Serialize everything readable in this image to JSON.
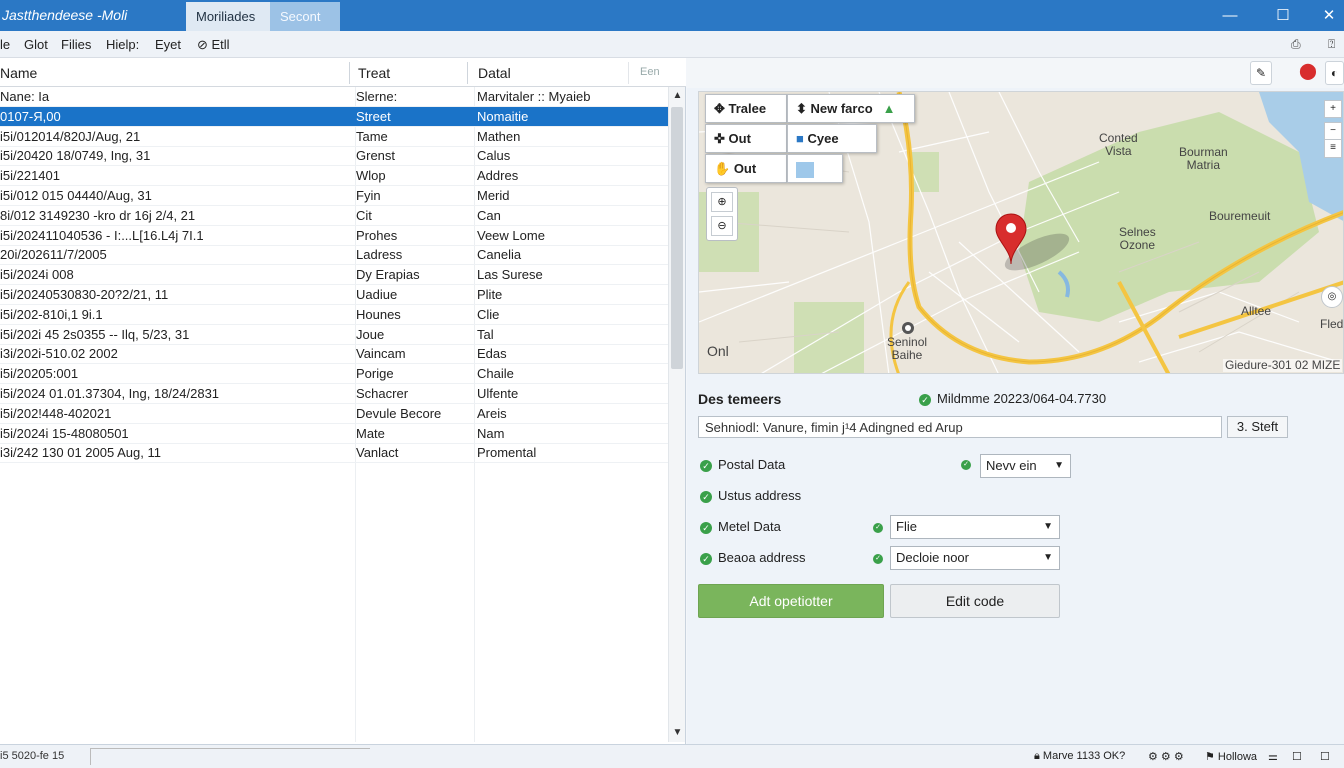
{
  "window": {
    "title": "Jastthendeese -Moli",
    "tabs": [
      "Moriliades",
      "Secont"
    ],
    "controls": {
      "minimize": "—",
      "maximize": "☐",
      "close": "✕"
    }
  },
  "menu": {
    "items": [
      "le",
      "Glot",
      "Filies",
      "Hielp:",
      "Eyet",
      "Etll"
    ],
    "right_icons": [
      "print-icon",
      "help-icon"
    ]
  },
  "table": {
    "columns": [
      "Name",
      "Treat",
      "Datal"
    ],
    "extra_header": "Een",
    "selected_index": 1,
    "rows": [
      [
        "Nane: Ia",
        "Slerne:",
        "Marvitaler :: Myaieb"
      ],
      [
        "0107-Я,00",
        "Street",
        "Nomaitie"
      ],
      [
        "i5i/012014/820J/Aug, 21",
        "Tame",
        "Mathen"
      ],
      [
        "i5i/20420 18/0749, Ing, 31",
        "Grenst",
        "Calus"
      ],
      [
        "i5i/221401",
        "Wlop",
        "Addres"
      ],
      [
        "i5i/012 015 04440/Aug, 31",
        "Fyin",
        "Merid"
      ],
      [
        "8i/012 3149230 -kro dr 16j 2/4, 21",
        "Cit",
        "Can"
      ],
      [
        "i5i/202411040536 - I:...L[16.L4j 7I.1",
        "Prohes",
        "Veew Lome"
      ],
      [
        "20i/202611/7/2005",
        "Ladress",
        "Canelia"
      ],
      [
        "i5i/2024i 008",
        "Dy Erapias",
        "Las Surese"
      ],
      [
        "i5i/20240530830-20?2/21, 11",
        "Uadiue",
        "Plite"
      ],
      [
        "i5i/202-810i,1 9i.1",
        "Hounes",
        "Clie"
      ],
      [
        "i5i/202i 45 2s0355 -- Ilq, 5/23, 31",
        "Joue",
        "Tal"
      ],
      [
        "i3i/202i-510.02 2002",
        "Vaincam",
        "Edas"
      ],
      [
        "i5i/20205:001",
        "Porige",
        "Chaile"
      ],
      [
        "i5i/2024 01.01.37304, Ing, 18/24/2831",
        "Schacrer",
        "Ulfente"
      ],
      [
        "i5i/202!448-402021",
        "Devule Becore",
        "Areis"
      ],
      [
        "i5i/2024i 15-48080501",
        "Mate",
        "Nam"
      ],
      [
        "i3i/242 130 01 2005 Aug, 11",
        "Vanlact",
        "Promental"
      ]
    ]
  },
  "status": {
    "left": "i5 5020-fe 15",
    "items": [
      "Marve 1133 OK?",
      "Hollowa"
    ]
  },
  "map": {
    "controls": [
      "Tralee",
      "New farco",
      "Out",
      "Cyee",
      "Out"
    ],
    "labels": {
      "p1": "Conted\nVista",
      "p2": "Bourman\nMatria",
      "p3": "Bouremeuit",
      "p4": "Selnes\nOzone",
      "p5": "Alltee",
      "p6": "Fled",
      "p7": "Seninol\nBaihe",
      "p8": "Onl"
    },
    "footer": "Giedure-301 02 MIZE",
    "accent_road": "#f4c542",
    "park_color": "#c7dba9",
    "water_color": "#a9cde8",
    "pin_color": "#d82d2d"
  },
  "details": {
    "title": "Des temeers",
    "modified": "Mildmme 20223/064-04.7730",
    "search_value": "Sehniodl: Vanure, fimin j¹4 Adingned ed Arup",
    "small_button": "3. Steft",
    "options": [
      {
        "label": "Postal Data",
        "dropdown": "Nevv ein"
      },
      {
        "label": "Ustus address",
        "dropdown": null
      },
      {
        "label": "Metel Data",
        "dropdown": "Flie"
      },
      {
        "label": "Beaoa address",
        "dropdown": "Decloie noor"
      }
    ],
    "primary_button": "Adt opetiotter",
    "secondary_button": "Edit code"
  }
}
